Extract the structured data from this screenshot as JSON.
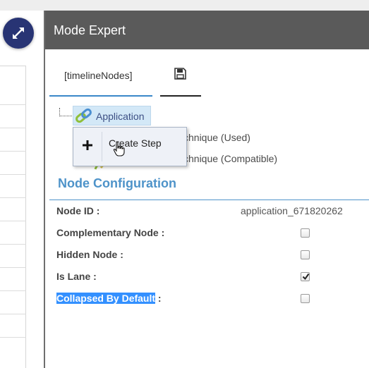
{
  "dialog": {
    "title": "Mode Expert"
  },
  "tabs": {
    "nodes_label": "[timelineNodes]",
    "save_icon": "save-icon"
  },
  "tree": {
    "root_label": "Application",
    "root_icon": "link-icon",
    "children": [
      {
        "label": "chnique (Used)"
      },
      {
        "label": "chnique (Compatible)"
      }
    ]
  },
  "context_menu": {
    "item_label": "Create Step",
    "item_icon": "plus-icon"
  },
  "node_configuration": {
    "title": "Node Configuration",
    "fields": [
      {
        "label": "Node ID :",
        "value": "application_671820262"
      },
      {
        "label": "Complementary Node :",
        "checked": false
      },
      {
        "label": "Hidden Node :",
        "checked": false
      },
      {
        "label": "Is Lane :",
        "checked": true
      },
      {
        "label_highlighted": "Collapsed By Default",
        "label_rest": " :",
        "checked": false
      }
    ]
  },
  "colors": {
    "header_bg": "#5a5a5a",
    "accent_blue": "#4e93c9",
    "fab_bg": "#283474",
    "selection_bg": "#d3e8f7"
  }
}
